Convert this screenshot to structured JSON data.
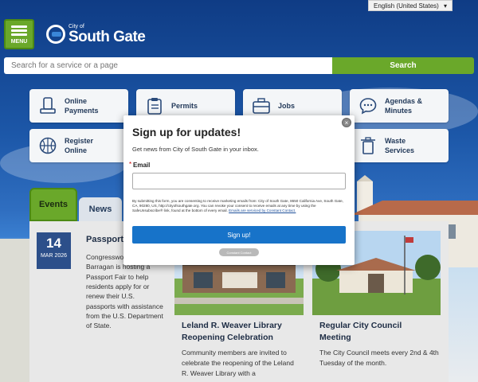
{
  "header": {
    "language": "English (United States)",
    "menu_label": "MENU",
    "logo_small": "City of",
    "logo_name": "South Gate"
  },
  "search": {
    "placeholder": "Search for a service or a page",
    "button": "Search"
  },
  "tiles": [
    {
      "label1": "Online",
      "label2": "Payments",
      "icon": "payment-terminal-icon"
    },
    {
      "label1": "Permits",
      "label2": "",
      "icon": "clipboard-icon"
    },
    {
      "label1": "Jobs",
      "label2": "",
      "icon": "briefcase-icon"
    },
    {
      "label1": "Agendas &",
      "label2": "Minutes",
      "icon": "chat-bubble-icon"
    },
    {
      "label1": "Register",
      "label2": "Online",
      "icon": "basketball-icon"
    },
    {
      "label1": "Waste",
      "label2": "Services",
      "icon": "trash-can-icon"
    }
  ],
  "tabs": {
    "events": "Events",
    "news": "News"
  },
  "events": [
    {
      "day": "14",
      "month": "MAR 2026",
      "title": "Passport",
      "description": "Congresswoman Nanette Barragan is hosting a Passport Fair to help residents apply for or renew their U.S. passports with assistance from the U.S. Department of State."
    },
    {
      "title1": "Leland R. Weaver Library",
      "title2": "Reopening Celebration",
      "description": "Community members are invited to celebrate the reopening of the Leland R. Weaver Library with a"
    },
    {
      "title1": "Regular City Council",
      "title2": "Meeting",
      "description": "The City Council meets every 2nd & 4th Tuesday of the month."
    }
  ],
  "modal": {
    "title": "Sign up for updates!",
    "subtitle": "Get news from City of South Gate in your inbox.",
    "required_mark": "*",
    "email_label": "Email",
    "legal": "By submitting this form, you are consenting to receive marketing emails from: City of South Gate, 8650 California Ave, South Gate, CA, 90280, US, http://cityofsouthgate.org. You can revoke your consent to receive emails at any time by using the SafeUnsubscribe® link, found at the bottom of every email.",
    "legal_link": "Emails are serviced by Constant Contact.",
    "signup_button": "Sign up!",
    "badge": "Constant Contact",
    "close": "×"
  },
  "colors": {
    "accent_green": "#6aa82a",
    "brand_blue": "#1f5aa6",
    "signup_blue": "#1773c9"
  }
}
